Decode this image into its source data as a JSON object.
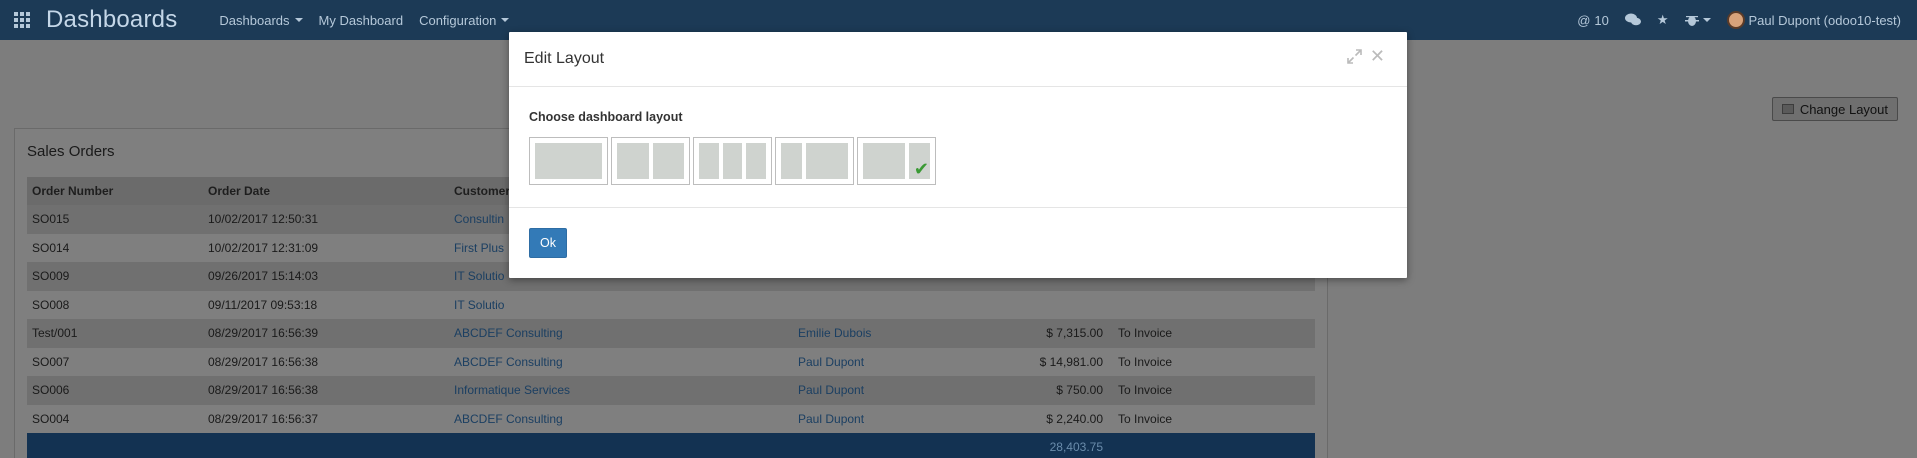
{
  "topbar": {
    "brand": "Dashboards",
    "menu": [
      {
        "label": "Dashboards",
        "dropdown": true
      },
      {
        "label": "My Dashboard",
        "dropdown": false
      },
      {
        "label": "Configuration",
        "dropdown": true
      }
    ],
    "systray": {
      "mentions_count": "10",
      "user": "Paul Dupont (odoo10-test)"
    }
  },
  "dashboard": {
    "change_layout_label": "Change Layout",
    "panel_title": "Sales Orders",
    "columns": [
      "Order Number",
      "Order Date",
      "Customer",
      "",
      "",
      ""
    ],
    "rows": [
      {
        "number": "SO015",
        "date": "10/02/2017 12:50:31",
        "customer": "Consultin",
        "salesperson": "",
        "total": "",
        "status": ""
      },
      {
        "number": "SO014",
        "date": "10/02/2017 12:31:09",
        "customer": "First Plus",
        "salesperson": "",
        "total": "",
        "status": ""
      },
      {
        "number": "SO009",
        "date": "09/26/2017 15:14:03",
        "customer": "IT Solutio",
        "salesperson": "",
        "total": "",
        "status": ""
      },
      {
        "number": "SO008",
        "date": "09/11/2017 09:53:18",
        "customer": "IT Solutio",
        "salesperson": "",
        "total": "",
        "status": ""
      },
      {
        "number": "Test/001",
        "date": "08/29/2017 16:56:39",
        "customer": "ABCDEF Consulting",
        "salesperson": "Emilie Dubois",
        "total": "$ 7,315.00",
        "status": "To Invoice"
      },
      {
        "number": "SO007",
        "date": "08/29/2017 16:56:38",
        "customer": "ABCDEF Consulting",
        "salesperson": "Paul Dupont",
        "total": "$ 14,981.00",
        "status": "To Invoice"
      },
      {
        "number": "SO006",
        "date": "08/29/2017 16:56:38",
        "customer": "Informatique Services",
        "salesperson": "Paul Dupont",
        "total": "$ 750.00",
        "status": "To Invoice"
      },
      {
        "number": "SO004",
        "date": "08/29/2017 16:56:37",
        "customer": "ABCDEF Consulting",
        "salesperson": "Paul Dupont",
        "total": "$ 2,240.00",
        "status": "To Invoice"
      }
    ],
    "grand_total": "28,403.75"
  },
  "modal": {
    "title": "Edit Layout",
    "body_label": "Choose dashboard layout",
    "layouts": [
      {
        "columns": [
          1
        ],
        "selected": false
      },
      {
        "columns": [
          1,
          1
        ],
        "selected": false
      },
      {
        "columns": [
          1,
          1,
          1
        ],
        "selected": false
      },
      {
        "columns": [
          1,
          2
        ],
        "selected": false
      },
      {
        "columns": [
          2,
          1
        ],
        "selected": true
      }
    ],
    "ok_label": "Ok"
  },
  "colors": {
    "navbar": "#1c3a56",
    "primary_button": "#337ab7",
    "checkmark": "#3a9a34"
  }
}
